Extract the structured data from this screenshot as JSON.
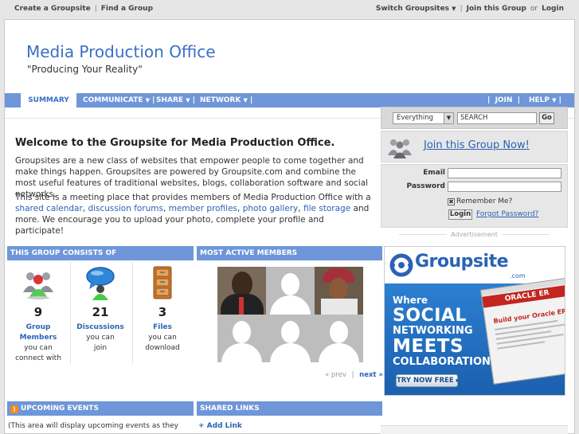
{
  "topbar": {
    "create_groupsite": "Create a Groupsite",
    "find_group": "Find a Group",
    "switch_groupsites": "Switch Groupsites",
    "join_this_group": "Join this Group",
    "or": "or",
    "login": "Login"
  },
  "site": {
    "title": "Media Production Office",
    "slogan": "\"Producing Your Reality\""
  },
  "nav": {
    "summary": "SUMMARY",
    "communicate": "COMMUNICATE",
    "share": "SHARE",
    "network": "NETWORK",
    "join": "JOIN",
    "help": "HELP"
  },
  "welcome": {
    "heading": "Welcome to the Groupsite for Media Production Office.",
    "para1": "Groupsites are a new class of websites that empower people to come together and make things happen. Groupsites are powered by Groupsite.com and combine the most useful features of traditional websites, blogs, collaboration software and social networks.",
    "para2_start": "This site is a meeting place that provides members of Media Production Office with a ",
    "link_calendar": "shared calendar",
    "comma1": ", ",
    "link_forums": "discussion forums",
    "comma2": ", ",
    "link_profiles": "member profiles",
    "comma3": ", ",
    "link_gallery": "photo gallery",
    "comma4": ", ",
    "link_storage": "file storage",
    "para2_end": " and more. We encourage you to upload your photo, complete your profile and participate!"
  },
  "consists": {
    "heading": "THIS GROUP CONSISTS OF",
    "members": {
      "num": "9",
      "label1": "Group",
      "label2": "Members",
      "desc1": "you can",
      "desc2": "connect with"
    },
    "discussions": {
      "num": "21",
      "label1": "Discussions",
      "desc1": "you can",
      "desc2": "join"
    },
    "files": {
      "num": "3",
      "label1": "Files",
      "desc1": "you can",
      "desc2": "download"
    }
  },
  "active": {
    "heading": "MOST ACTIVE MEMBERS",
    "prev": "« prev",
    "pipe": "|",
    "next": "next »"
  },
  "events": {
    "heading": "UPCOMING EVENTS",
    "text": "(This area will display upcoming events as they"
  },
  "links": {
    "heading": "SHARED LINKS",
    "add": "+ Add Link"
  },
  "search": {
    "scope": "Everything",
    "placeholder": "SEARCH",
    "go": "Go"
  },
  "join_box": {
    "text": "Join this Group Now!"
  },
  "login_box": {
    "email_label": "Email",
    "password_label": "Password",
    "remember": "Remember Me?",
    "login_button": "Login",
    "forgot": "Forgot Password?"
  },
  "ad": {
    "label": "Advertisement",
    "logo": "Groupsite",
    "dotcom": ".com",
    "l1": "Where",
    "l2": "SOCIAL",
    "l3": "NETWORKING",
    "l4": "MEETS",
    "l5": "COLLABORATION",
    "cta": "TRY NOW FREE ▸",
    "shot_brand": "ORACLE ER",
    "shot_title": "Build your Oracle ERP"
  },
  "colors": {
    "accent": "#6e96d9",
    "link": "#2a63b5",
    "title": "#3a6fc4"
  }
}
